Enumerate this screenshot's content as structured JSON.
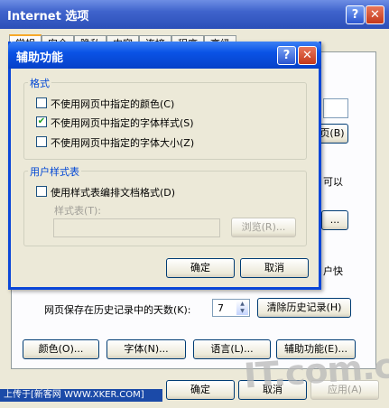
{
  "outer": {
    "title": "Internet 选项",
    "tabs": [
      "常规",
      "安全",
      "隐私",
      "内容",
      "连接",
      "程序",
      "高级"
    ],
    "button_partial_1": "页(B)",
    "text_partial_1": "可以",
    "button_partial_2": "...",
    "text_partial_2": "户快",
    "history_days_label": "网页保存在历史记录中的天数(K):",
    "history_days_value": "7",
    "clear_history_label": "清除历史记录(H)",
    "colors_label": "颜色(O)...",
    "fonts_label": "字体(N)...",
    "languages_label": "语言(L)...",
    "accessibility_label": "辅助功能(E)...",
    "ok_label": "确定",
    "cancel_label": "取消",
    "apply_label": "应用(A)",
    "help_icon": "?",
    "close_icon": "✕",
    "watermark": "IT.com.cn",
    "credit_text": "上传于[新客网 WWW.XKER.COM]"
  },
  "dialog": {
    "title": "辅助功能",
    "help_icon": "?",
    "close_icon": "✕",
    "format_group": {
      "legend": "格式",
      "items": [
        {
          "label": "不使用网页中指定的颜色(C)",
          "checked": false
        },
        {
          "label": "不使用网页中指定的字体样式(S)",
          "checked": true
        },
        {
          "label": "不使用网页中指定的字体大小(Z)",
          "checked": false
        }
      ]
    },
    "stylesheet_group": {
      "legend": "用户样式表",
      "checkbox_label": "使用样式表编排文档格式(D)",
      "checked": false,
      "stylesheet_label": "样式表(T):",
      "stylesheet_value": "",
      "browse_label": "浏览(R)..."
    },
    "ok_label": "确定",
    "cancel_label": "取消"
  },
  "colors": {
    "title_bar": "#0a53e6",
    "accent_orange": "#f6a92b",
    "group_legend": "#0046d5"
  }
}
